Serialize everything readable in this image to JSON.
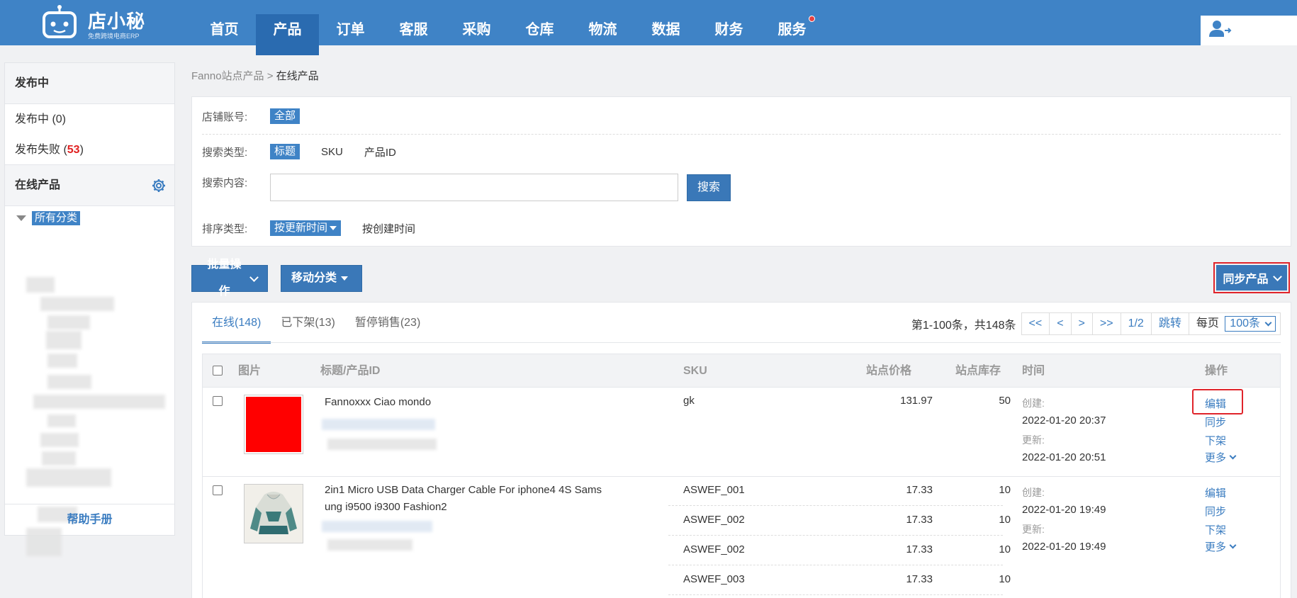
{
  "brand": {
    "name": "店小秘",
    "tagline": "免费跨境电商ERP"
  },
  "nav": {
    "items": [
      "首页",
      "产品",
      "订单",
      "客服",
      "采购",
      "仓库",
      "物流",
      "数据",
      "财务",
      "服务"
    ],
    "active_index": 1
  },
  "sidebar": {
    "publishing_title": "发布中",
    "publishing_item": "发布中 (0)",
    "failed_prefix": "发布失败 (",
    "failed_count": "53",
    "failed_suffix": ")",
    "online_title": "在线产品",
    "all_categories": "所有分类",
    "help": "帮助手册"
  },
  "breadcrumb": {
    "parent": "Fanno站点产品",
    "sep": " > ",
    "current": "在线产品"
  },
  "filter": {
    "store_label": "店铺账号:",
    "store_value": "全部",
    "search_type_label": "搜索类型:",
    "search_types": [
      "标题",
      "SKU",
      "产品ID"
    ],
    "search_content_label": "搜索内容:",
    "search_placeholder": "",
    "search_button": "搜索",
    "sort_label": "排序类型:",
    "sort_active": "按更新时间",
    "sort_other": "按创建时间"
  },
  "actions": {
    "batch": "批量操作",
    "move": "移动分类",
    "sync": "同步产品"
  },
  "tabs": [
    {
      "label": "在线(148)",
      "active": true
    },
    {
      "label": "已下架(13)",
      "active": false
    },
    {
      "label": "暂停销售(23)",
      "active": false
    }
  ],
  "pager": {
    "info": "第1-100条，共148条",
    "first": "<<",
    "prev": "<",
    "next": ">",
    "last": ">>",
    "page": "1/2",
    "jump": "跳转",
    "per_page_label": "每页",
    "per_page": "100条"
  },
  "table": {
    "headers": {
      "image": "图片",
      "title": "标题/产品ID",
      "sku": "SKU",
      "price": "站点价格",
      "stock": "站点库存",
      "time": "时间",
      "ops": "操作"
    },
    "rows": [
      {
        "title_line1": "Fannoxxx Ciao mondo",
        "title_line2": "",
        "skus": [
          {
            "sku": "gk",
            "price": "131.97",
            "stock": "50"
          }
        ],
        "created_label": "创建:",
        "created": "2022-01-20 20:37",
        "updated_label": "更新:",
        "updated": "2022-01-20 20:51",
        "ops": {
          "edit": "编辑",
          "sync": "同步",
          "delist": "下架",
          "more": "更多"
        }
      },
      {
        "title_line1": "2in1 Micro USB Data Charger Cable For iphone4 4S Sams",
        "title_line2": "ung i9500 i9300 Fashion2",
        "skus": [
          {
            "sku": "ASWEF_001",
            "price": "17.33",
            "stock": "10"
          },
          {
            "sku": "ASWEF_002",
            "price": "17.33",
            "stock": "10"
          },
          {
            "sku": "ASWEF_002",
            "price": "17.33",
            "stock": "10"
          },
          {
            "sku": "ASWEF_003",
            "price": "17.33",
            "stock": "10"
          }
        ],
        "created_label": "创建:",
        "created": "2022-01-20 19:49",
        "updated_label": "更新:",
        "updated": "2022-01-20 19:49",
        "ops": {
          "edit": "编辑",
          "sync": "同步",
          "delist": "下架",
          "more": "更多"
        }
      }
    ]
  },
  "colors": {
    "primary": "#3f83c6",
    "button": "#3a78b8",
    "highlight": "#e0242b",
    "image_red": "#ff0000"
  }
}
